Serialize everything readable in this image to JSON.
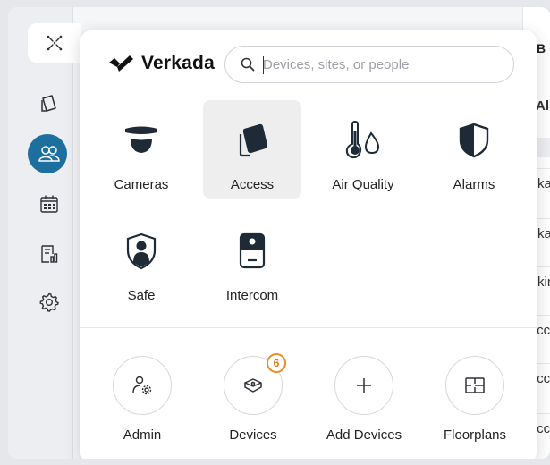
{
  "background": {
    "header_letter": "B",
    "column_label": "All",
    "row_fragments": [
      "rka",
      "rka",
      "rkir",
      ".cc",
      ".cc",
      ".cc"
    ]
  },
  "rail": {
    "items": [
      {
        "icon": "access-card-icon"
      },
      {
        "icon": "people-icon",
        "active": true
      },
      {
        "icon": "calendar-icon"
      },
      {
        "icon": "reports-icon"
      },
      {
        "icon": "gear-icon"
      }
    ],
    "launcher_icon": "app-grid-icon"
  },
  "brand": {
    "name": "Verkada",
    "logo": "verkada-logo"
  },
  "search": {
    "placeholder": "Devices, sites, or people",
    "value": ""
  },
  "products": [
    {
      "label": "Cameras",
      "icon": "camera-icon"
    },
    {
      "label": "Access",
      "icon": "access-card-icon",
      "selected": true
    },
    {
      "label": "Air Quality",
      "icon": "air-quality-icon"
    },
    {
      "label": "Alarms",
      "icon": "alarm-shield-icon"
    },
    {
      "label": "Safe",
      "icon": "safe-shield-person-icon"
    },
    {
      "label": "Intercom",
      "icon": "intercom-icon"
    }
  ],
  "shortcuts": [
    {
      "label": "Admin",
      "icon": "admin-gear-person-icon"
    },
    {
      "label": "Devices",
      "icon": "device-icon",
      "badge": "6"
    },
    {
      "label": "Add Devices",
      "icon": "plus-icon"
    },
    {
      "label": "Floorplans",
      "icon": "floorplan-icon"
    }
  ],
  "colors": {
    "accent": "#1d6fa0",
    "badge": "#f08a24",
    "icon_dark": "#1f2a37"
  }
}
